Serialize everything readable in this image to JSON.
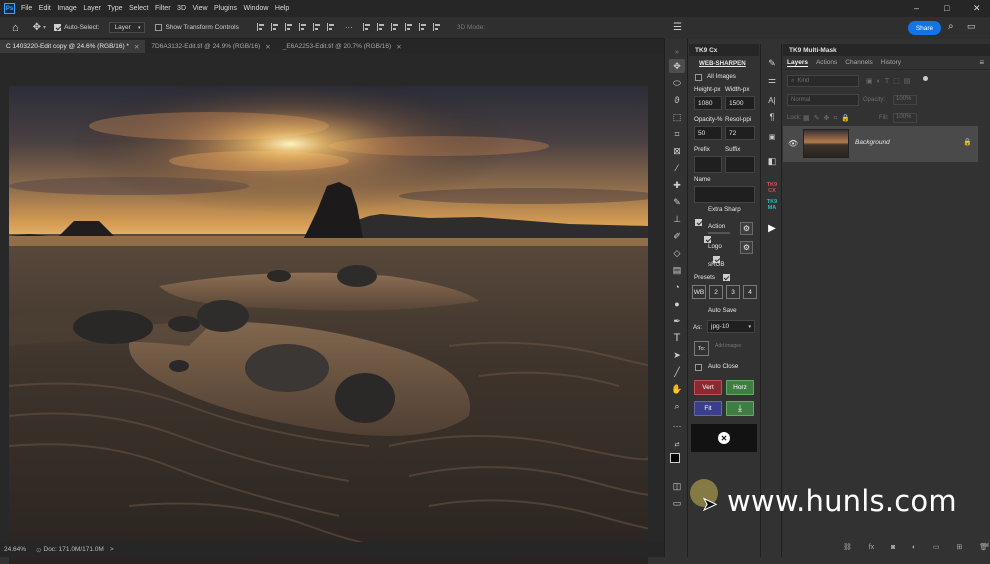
{
  "menubar": {
    "items": [
      "File",
      "Edit",
      "Image",
      "Layer",
      "Type",
      "Select",
      "Filter",
      "3D",
      "View",
      "Plugins",
      "Window",
      "Help"
    ],
    "window_controls": [
      "–",
      "□",
      "✕"
    ]
  },
  "optionsbar": {
    "auto_select_label": "Auto-Select:",
    "auto_select_target": "Layer",
    "show_transform_label": "Show Transform Controls",
    "three_d_mode": "3D Mode:",
    "share_label": "Share"
  },
  "tabs": [
    {
      "label": "C 1403220-Edit copy @ 24.6% (RGB/16) *"
    },
    {
      "label": "7D6A3132-Edit.tif @ 24.9% (RGB/16)"
    },
    {
      "label": "_E6A2253-Edit.tif @ 20.7% (RGB/16)"
    }
  ],
  "status": {
    "zoom": "24.64%",
    "doc": "Doc: 171.0M/171.0M",
    "arrow": ">"
  },
  "tk9cx": {
    "title": "TK9 Cx",
    "web_sharpen": "WEB-SHARPEN",
    "all_images": "All Images",
    "height_label": "Height-px",
    "width_label": "Width-px",
    "height_value": "1080",
    "width_value": "1500",
    "opacity_label": "Opacity-%",
    "resol_label": "Resol-ppi",
    "opacity_value": "50",
    "resol_value": "72",
    "prefix_label": "Prefix",
    "suffix_label": "Suffix",
    "name_label": "Name",
    "extra_sharp": "Extra Sharp",
    "action": "Action",
    "logo": "Logo",
    "srgb": "sRGB",
    "presets_label": "Presets",
    "presets": [
      "WB",
      "2",
      "3",
      "4"
    ],
    "auto_save": "Auto Save",
    "as_label": "As:",
    "format": "jpg-10",
    "to_label": "To:",
    "add_images": "Add images",
    "auto_close": "Auto Close",
    "vert": "Vert",
    "horz": "Horz",
    "fit": "Fit",
    "colors": {
      "vert": "#8a2a2f",
      "horz": "#3f7d44",
      "fit": "#3a3f8c",
      "download": "#3f7d44"
    }
  },
  "multimask": {
    "title": "TK9 Multi-Mask",
    "tabs": [
      "Layers",
      "Actions",
      "Channels",
      "History"
    ],
    "kind": "Kind",
    "blend_mode": "Normal",
    "opacity_label": "Opacity:",
    "opacity_value": "100%",
    "lock_label": "Lock:",
    "fill_label": "Fill:",
    "fill_value": "100%",
    "layer_name": "Background"
  },
  "iconcol": {
    "tk9_cx_badge": "TK9 CX",
    "tk9_ma_badge": "TK9 MA"
  },
  "watermark": "www.hunls.com"
}
